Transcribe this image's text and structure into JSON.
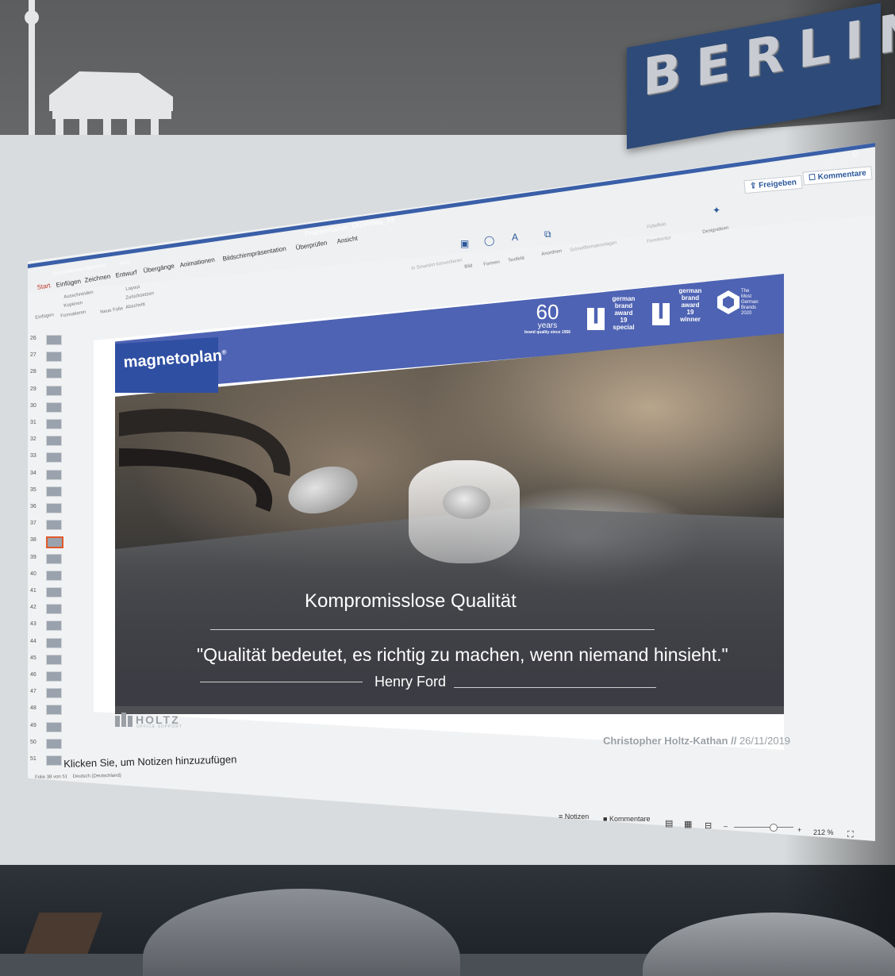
{
  "wall_sign": {
    "text": "BERLIN"
  },
  "window": {
    "title": "Praesentation_DGVerlag_19",
    "autosave_label": "Automatisches Speichern",
    "autosave_state": "AUS"
  },
  "ribbon": {
    "tabs": [
      "Start",
      "Einfügen",
      "Zeichnen",
      "Entwurf",
      "Übergänge",
      "Animationen",
      "Bildschirmpräsentation",
      "Überprüfen",
      "Ansicht"
    ],
    "active_tab": "Start",
    "clipboard": {
      "paste": "Einfügen",
      "cut": "Ausschneiden",
      "copy": "Kopieren",
      "format": "Formatieren"
    },
    "slides": {
      "new_slide": "Neue Folie",
      "layout": "Layout",
      "reset": "Zurücksetzen",
      "section": "Abschnitt"
    },
    "smartart": "In SmartArt konvertieren",
    "insert": {
      "picture": "Bild",
      "shapes": "Formen",
      "textbox": "Textfeld"
    },
    "arrange": "Anordnen",
    "quick_styles": "Schnellformatvorlagen",
    "shape_fill": "Fülleffekt",
    "shape_outline": "Formkontur",
    "design_ideas": "Designideen",
    "share_button": "Freigeben",
    "comments_button": "Kommentare"
  },
  "thumbnails": {
    "numbers": [
      "26",
      "27",
      "28",
      "29",
      "30",
      "31",
      "32",
      "33",
      "34",
      "35",
      "36",
      "37",
      "38",
      "39",
      "40",
      "41",
      "42",
      "43",
      "44",
      "45",
      "46",
      "47",
      "48",
      "49",
      "50",
      "51"
    ],
    "active": "38"
  },
  "slide": {
    "logo": "magnetoplan",
    "logo_mark": "®",
    "badges": [
      {
        "line1": "60",
        "line2": "years",
        "line3": "brand quality since 1956"
      },
      {
        "lines": [
          "german",
          "brand",
          "award",
          "19",
          "special"
        ]
      },
      {
        "lines": [
          "german",
          "brand",
          "award",
          "19",
          "winner"
        ]
      },
      {
        "lines": [
          "The",
          "Most",
          "German",
          "Brands",
          "2020"
        ]
      }
    ],
    "title": "Kompromisslose Qualität",
    "quote": "\"Qualität bedeutet, es richtig zu machen, wenn niemand hinsieht.\"",
    "author": "Henry Ford",
    "footer_brand": "HOLTZ",
    "footer_brand_sub": "OFFICE SUPPORT",
    "presenter": "Christopher Holtz-Kathan",
    "date_sep": "//",
    "date": "26/11/2019"
  },
  "notes_placeholder": "Klicken Sie, um Notizen hinzuzufügen",
  "status": {
    "slide_info": "Folie 38 von 51",
    "language": "Deutsch (Deutschland)",
    "notes": "Notizen",
    "comments": "Kommentare",
    "zoom": "212 %",
    "zoom_minus": "–",
    "zoom_plus": "+"
  },
  "colors": {
    "accent": "#2b579a",
    "slide_header": "#4e63b3",
    "logo_box": "#2f4fa3",
    "berlin_sign": "#2e4a78",
    "active_thumb": "#e05a2a"
  }
}
